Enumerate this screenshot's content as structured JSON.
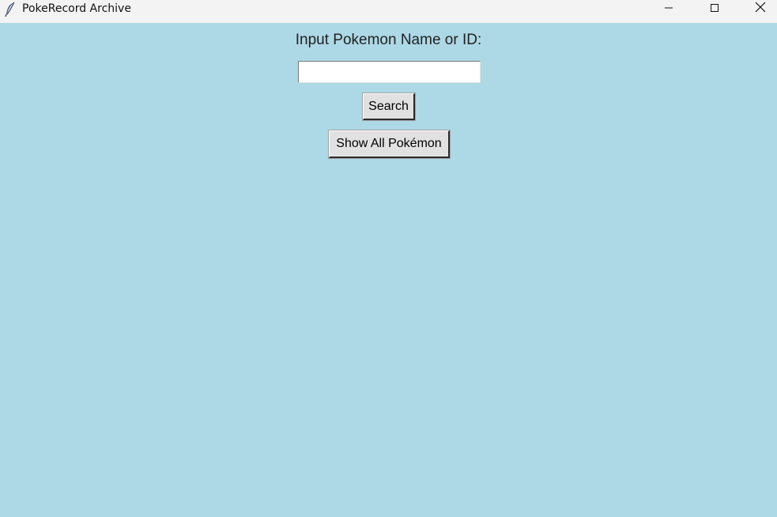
{
  "window": {
    "title": "PokeRecord Archive",
    "icon": "feather-icon",
    "background_color": "#add8e6",
    "controls": [
      "minimize-icon",
      "maximize-icon",
      "close-icon"
    ]
  },
  "main": {
    "prompt_label": "Input Pokemon Name or ID:",
    "search_input": {
      "value": "",
      "placeholder": ""
    },
    "search_button_label": "Search",
    "show_all_button_label": "Show All Pokémon"
  }
}
